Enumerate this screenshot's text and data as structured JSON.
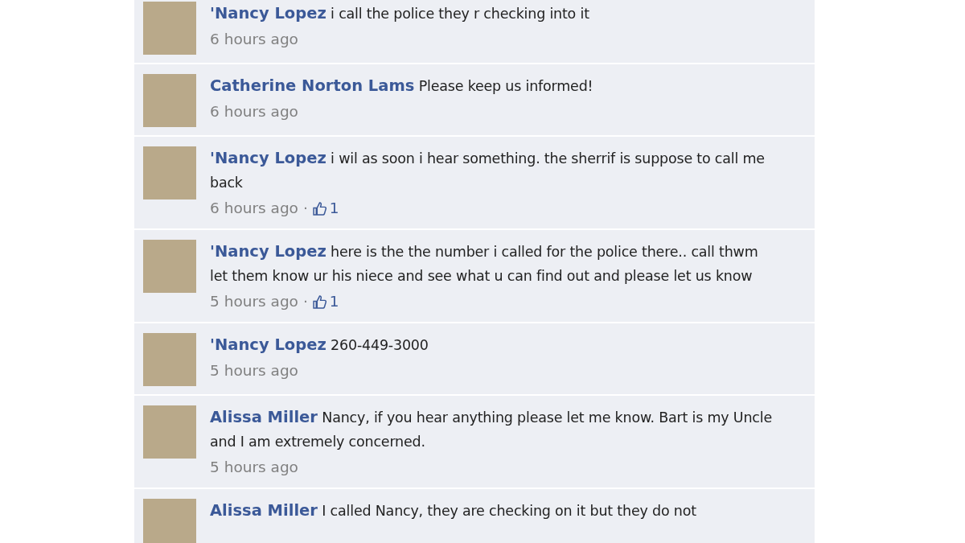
{
  "comments": [
    {
      "author": "'Nancy Lopez",
      "text": "i call the police they r checking into it",
      "time": "6 hours ago"
    },
    {
      "author": "Catherine Norton Lams",
      "text": "Please keep us informed!",
      "time": "6 hours ago"
    },
    {
      "author": "'Nancy Lopez",
      "text": "i wil as soon i hear something. the sherrif is suppose to call me back",
      "time": "6 hours ago",
      "separator": "·",
      "likes": "1"
    },
    {
      "author": "'Nancy Lopez",
      "text": "here is the the number i called for the police there.. call thwm let them know ur his niece and see what u can find out and please let us know",
      "time": "5 hours ago",
      "separator": "·",
      "likes": "1"
    },
    {
      "author": "'Nancy Lopez",
      "text": "260-449-3000",
      "time": "5 hours ago"
    },
    {
      "author": "Alissa Miller",
      "text": "Nancy, if you hear anything please let me know. Bart is my Uncle and I am extremely concerned.",
      "time": "5 hours ago"
    },
    {
      "author": "Alissa Miller",
      "text": "I called Nancy, they are checking on it but they do not"
    }
  ]
}
